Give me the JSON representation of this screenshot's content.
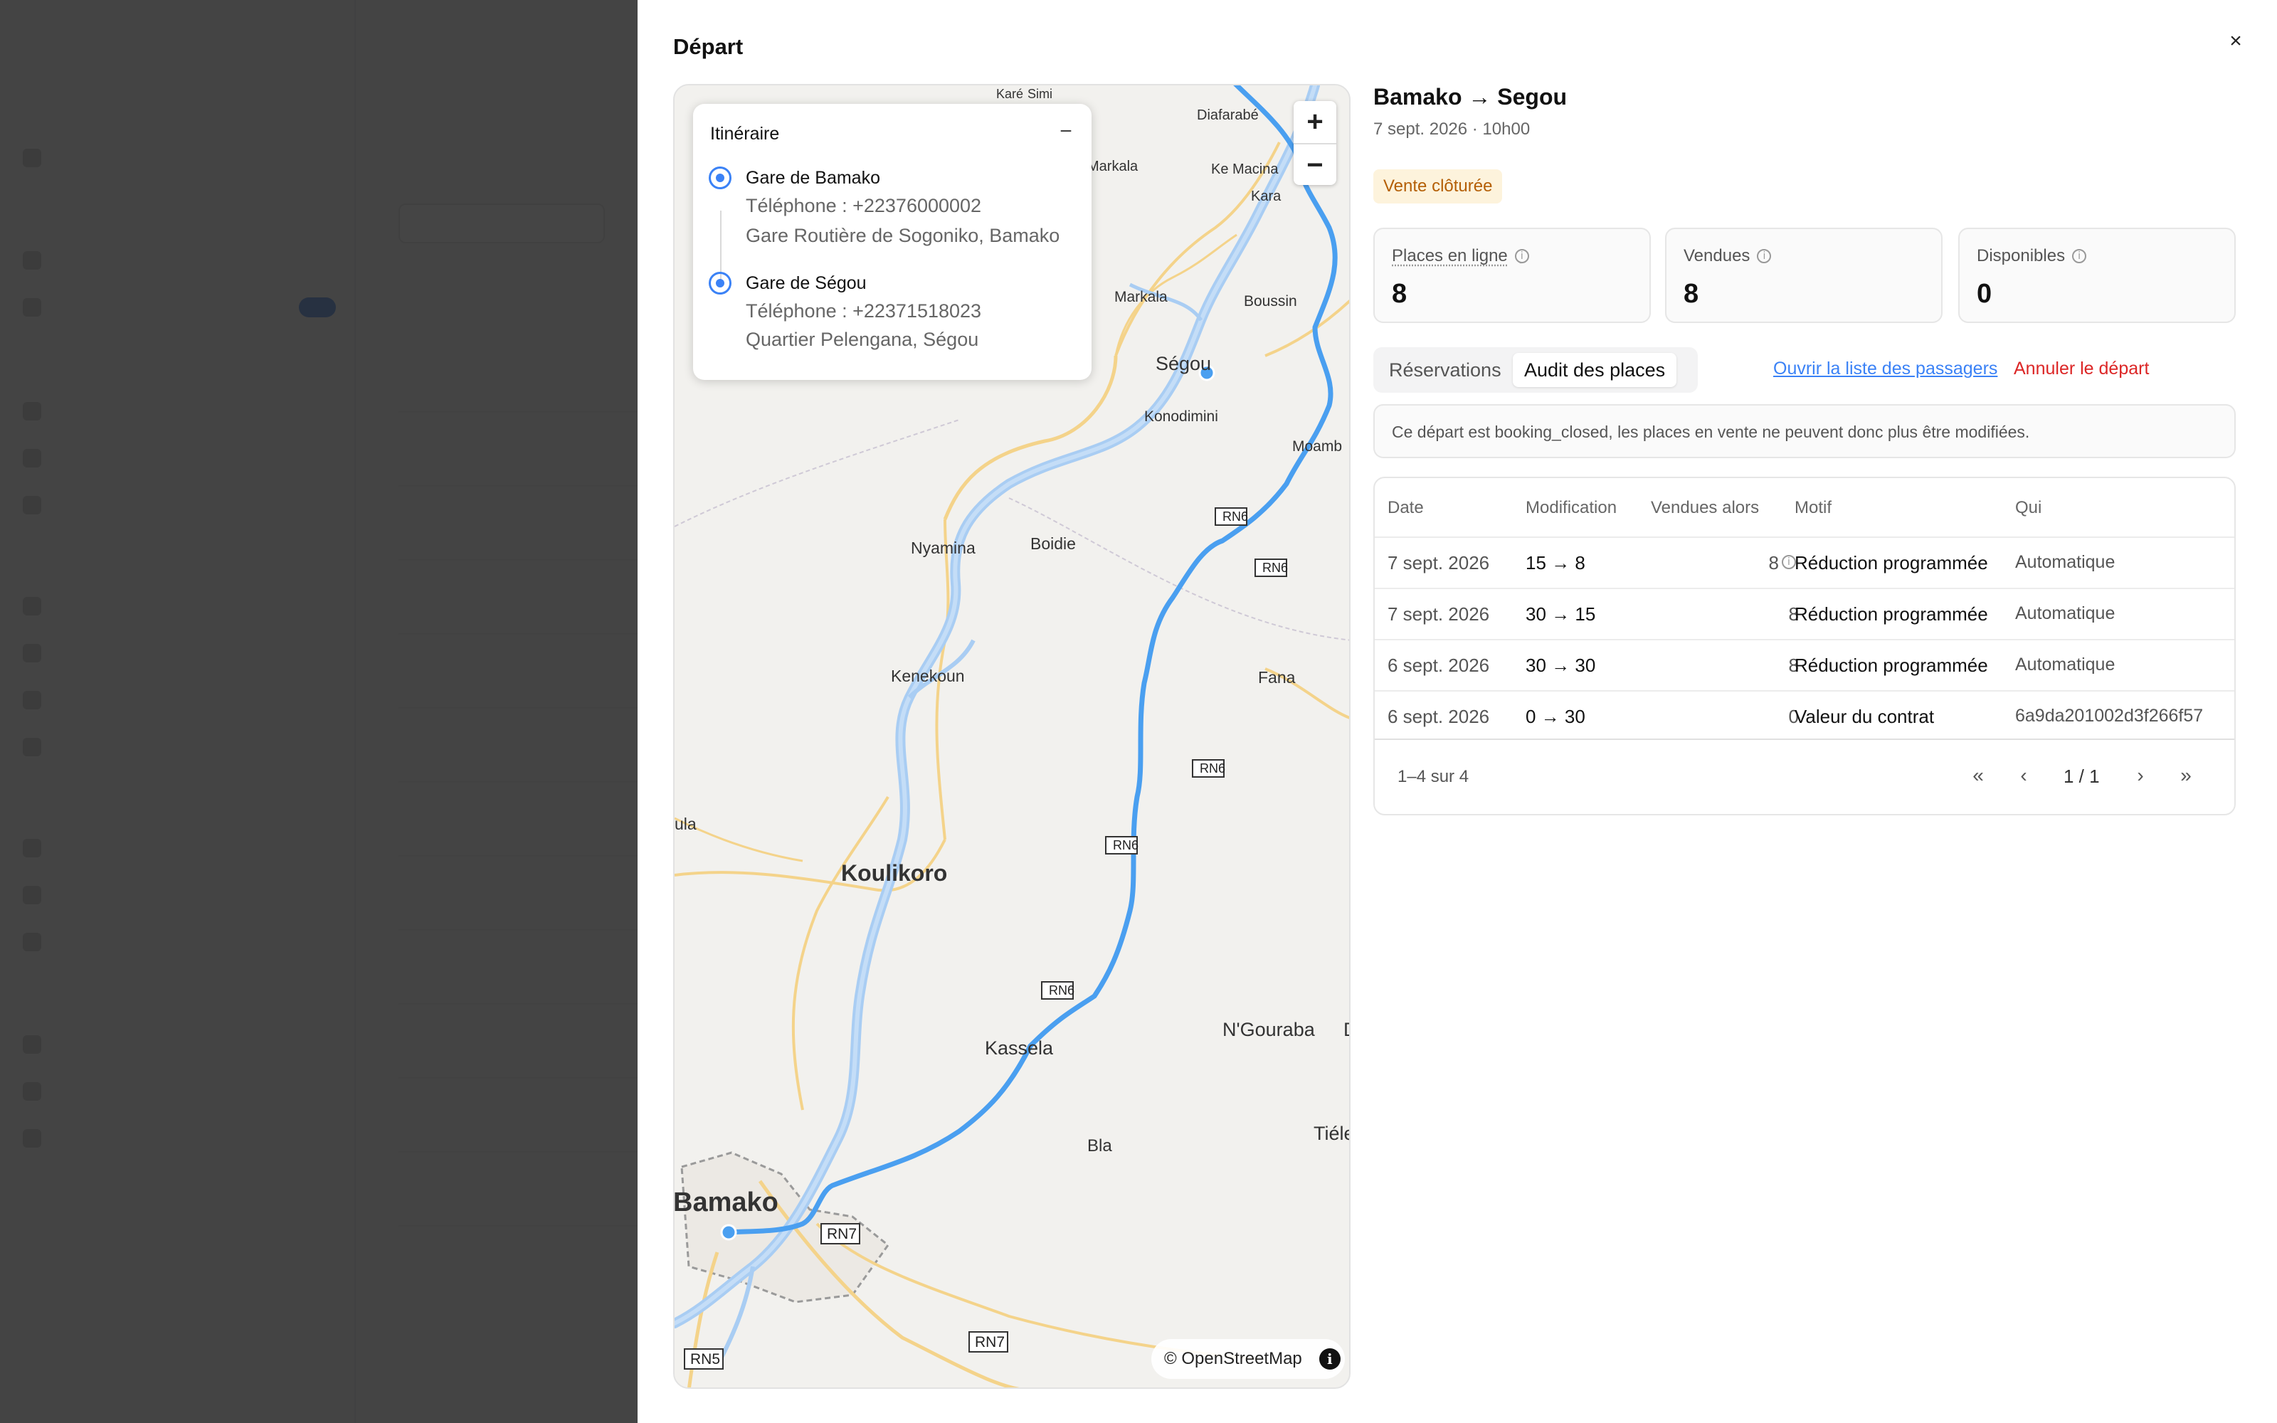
{
  "drawer": {
    "title": "Départ",
    "close": "×"
  },
  "map": {
    "zoom_in": "+",
    "zoom_out": "−",
    "attribution": "© OpenStreetMap",
    "info": "i",
    "labels": {
      "kare": "Karé",
      "simi": "Simi",
      "diafarabe": "Diafarabé",
      "markala_top": "Markala",
      "ke_macina": "Ke Macina",
      "kara": "Kara",
      "markala": "Markala",
      "boussin": "Boussin",
      "segou": "Ségou",
      "konodimini": "Konodimini",
      "moamb": "Moamb",
      "nyamina": "Nyamina",
      "boidie": "Boidie",
      "kenekoun": "Kenekoun",
      "fana": "Fana",
      "koulikoro": "Koulikoro",
      "kassela": "Kassela",
      "ngouraba": "N'Gouraba",
      "bla": "Bla",
      "tiele": "Tiéle",
      "bamako": "Bamako",
      "ula": "ula",
      "d": "D"
    },
    "roads": {
      "rn6": "RN6",
      "rn7": "RN7",
      "rn5": "RN5"
    }
  },
  "itinerary": {
    "title": "Itinéraire",
    "collapse": "−",
    "stops": [
      {
        "name": "Gare de Bamako",
        "phone": "Téléphone : +22376000002",
        "address": "Gare Routière de Sogoniko, Bamako"
      },
      {
        "name": "Gare de Ségou",
        "phone": "Téléphone : +22371518023",
        "address": "Quartier Pelengana, Ségou"
      }
    ]
  },
  "departure": {
    "route": "Bamako → Segou",
    "datetime": "7 sept. 2026 · 10h00",
    "status": "Vente clôturée"
  },
  "stats": [
    {
      "label": "Places en ligne",
      "value": "8"
    },
    {
      "label": "Vendues",
      "value": "8"
    },
    {
      "label": "Disponibles",
      "value": "0"
    }
  ],
  "tabs": {
    "reservations": "Réservations",
    "audit": "Audit des places"
  },
  "actions": {
    "open_passengers": "Ouvrir la liste des passagers",
    "cancel": "Annuler le départ"
  },
  "notice": "Ce départ est booking_closed, les places en vente ne peuvent donc plus être modifiées.",
  "audit": {
    "columns": [
      "Date",
      "Modification",
      "Vendues alors",
      "Motif",
      "Qui"
    ],
    "rows": [
      {
        "date": "7 sept. 2026",
        "change": "15 → 8",
        "sold": "8",
        "reason": "Réduction programmée",
        "who": "Automatique"
      },
      {
        "date": "7 sept. 2026",
        "change": "30 → 15",
        "sold": "8",
        "reason": "Réduction programmée",
        "who": "Automatique"
      },
      {
        "date": "6 sept. 2026",
        "change": "30 → 30",
        "sold": "8",
        "reason": "Réduction programmée",
        "who": "Automatique"
      },
      {
        "date": "6 sept. 2026",
        "change": "0 → 30",
        "sold": "0",
        "reason": "Valeur du contrat",
        "who": "6a9da201002d3f266f57"
      }
    ],
    "pagination": {
      "count": "1–4 sur 4",
      "first": "«",
      "prev": "‹",
      "page": "1 / 1",
      "next": "›",
      "last": "»"
    }
  }
}
